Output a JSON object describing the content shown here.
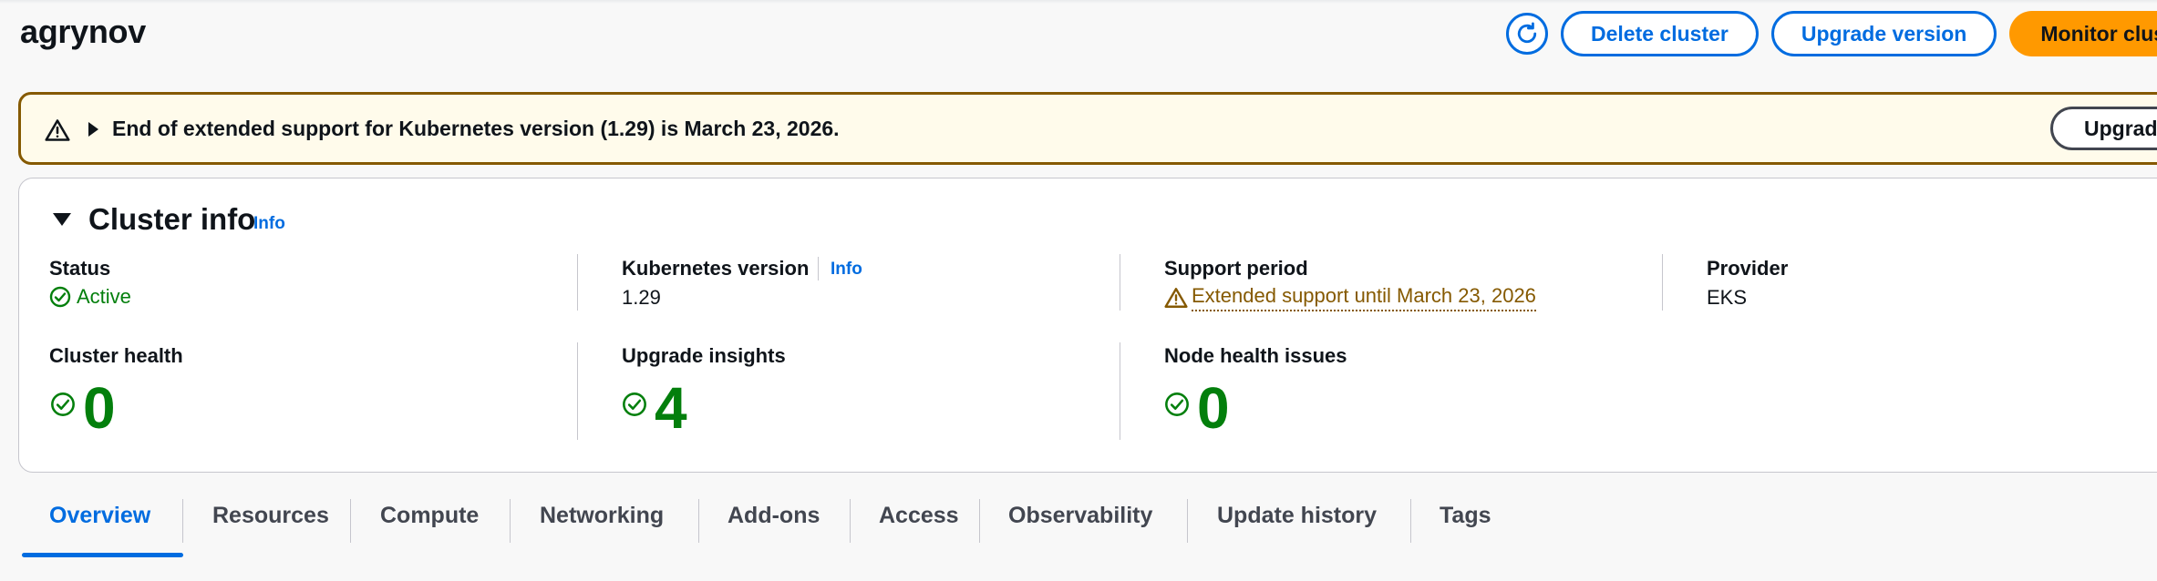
{
  "header": {
    "title": "agrynov",
    "refresh_icon": "refresh-icon",
    "delete_label": "Delete cluster",
    "upgrade_label": "Upgrade version",
    "monitor_label": "Monitor clus"
  },
  "flash": {
    "icon": "warning-icon",
    "message": "End of extended support for Kubernetes version (1.29) is March 23, 2026.",
    "button_label": "Upgrade"
  },
  "cluster_info": {
    "title": "Cluster info",
    "info_label": "Info",
    "status": {
      "label": "Status",
      "value": "Active"
    },
    "k8s_version": {
      "label": "Kubernetes version",
      "info_label": "Info",
      "value": "1.29"
    },
    "support_period": {
      "label": "Support period",
      "value": "Extended support until March 23, 2026"
    },
    "provider": {
      "label": "Provider",
      "value": "EKS"
    },
    "cluster_health": {
      "label": "Cluster health",
      "value": "0"
    },
    "upgrade_insights": {
      "label": "Upgrade insights",
      "value": "4"
    },
    "node_health": {
      "label": "Node health issues",
      "value": "0"
    }
  },
  "tabs": [
    {
      "label": "Overview",
      "active": true
    },
    {
      "label": "Resources"
    },
    {
      "label": "Compute"
    },
    {
      "label": "Networking"
    },
    {
      "label": "Add-ons"
    },
    {
      "label": "Access"
    },
    {
      "label": "Observability"
    },
    {
      "label": "Update history"
    },
    {
      "label": "Tags"
    }
  ],
  "colors": {
    "link": "#006ce0",
    "primary": "#ff9900",
    "success": "#037f0c",
    "warning": "#855900",
    "warning_bg": "#fffbeb"
  }
}
